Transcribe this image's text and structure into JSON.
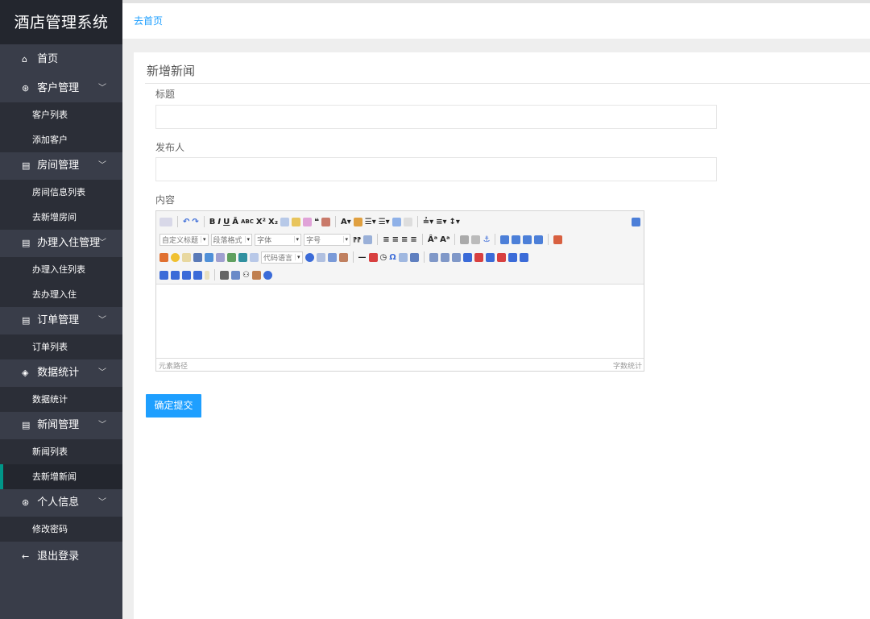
{
  "sidebar": {
    "logo": "酒店管理系统",
    "home": {
      "icon": "home-icon",
      "label": "首页"
    },
    "groups": [
      {
        "icon": "user-circle-icon",
        "label": "客户管理",
        "items": [
          "客户列表",
          "添加客户"
        ]
      },
      {
        "icon": "document-icon",
        "label": "房间管理",
        "items": [
          "房间信息列表",
          "去新增房间"
        ]
      },
      {
        "icon": "document-icon",
        "label": "办理入住管理",
        "items": [
          "办理入住列表",
          "去办理入住"
        ]
      },
      {
        "icon": "document-icon",
        "label": "订单管理",
        "items": [
          "订单列表"
        ]
      },
      {
        "icon": "layers-icon",
        "label": "数据统计",
        "items": [
          "数据统计"
        ]
      },
      {
        "icon": "document-icon",
        "label": "新闻管理",
        "items": [
          "新闻列表",
          "去新增新闻"
        ]
      },
      {
        "icon": "user-circle-icon",
        "label": "个人信息",
        "items": [
          "修改密码"
        ]
      }
    ],
    "logout": {
      "icon": "arrow-left-icon",
      "label": "退出登录"
    },
    "active_item": "去新增新闻"
  },
  "header": {
    "home_link": "去首页"
  },
  "form": {
    "title": "新增新闻",
    "title_label": "标题",
    "title_value": "",
    "publisher_label": "发布人",
    "publisher_value": "",
    "content_label": "内容",
    "submit": "确定提交"
  },
  "editor": {
    "selects": {
      "custom_title": "自定义标题",
      "paragraph": "段落格式",
      "font": "字体",
      "size": "字号",
      "code_lang": "代码语言"
    },
    "status_path": "元素路径",
    "word_count": "字数统计"
  },
  "colors": {
    "accent": "#1e9fff",
    "sidebar": "#393d49",
    "sidebar_sub": "#2b2e37",
    "active_bar": "#009688"
  }
}
